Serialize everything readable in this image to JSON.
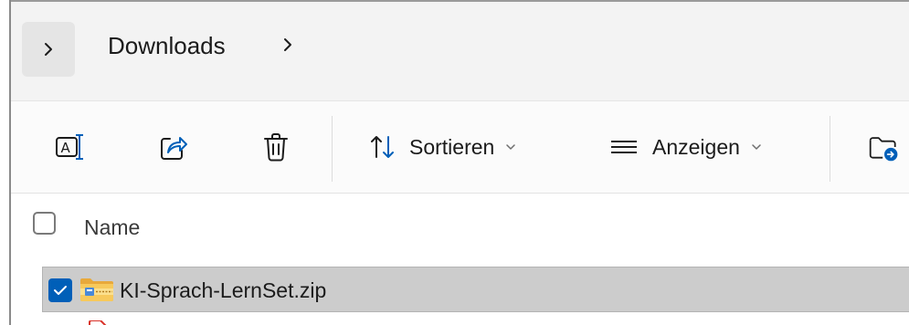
{
  "breadcrumb": {
    "current": "Downloads"
  },
  "toolbar": {
    "sort_label": "Sortieren",
    "view_label": "Anzeigen"
  },
  "list": {
    "header_name": "Name",
    "files": [
      {
        "name": "KI-Sprach-LernSet.zip",
        "selected": true,
        "icon": "zip-folder-icon"
      }
    ]
  },
  "colors": {
    "accent": "#005fb8",
    "selection": "#cccccc",
    "addressbar_bg": "#f3f3f3",
    "toolbar_bg": "#fbfbfb"
  }
}
